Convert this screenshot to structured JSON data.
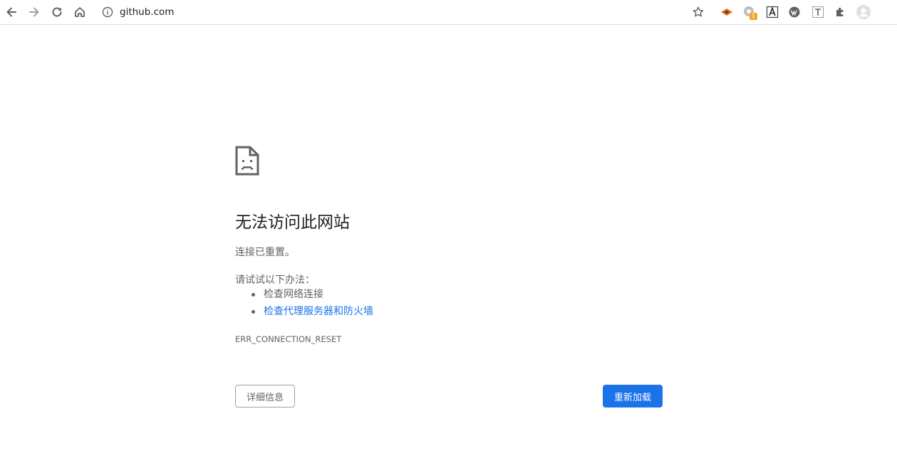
{
  "browser": {
    "url": "github.com",
    "icons": {
      "back": "arrow-left-icon",
      "forward": "arrow-right-icon",
      "reload": "reload-icon",
      "home": "home-icon",
      "site_info": "info-icon",
      "bookmark": "star-icon",
      "extensions": "puzzle-icon",
      "profile": "avatar-icon"
    },
    "extension_badge": "1"
  },
  "error_page": {
    "icon": "sad-document-icon",
    "title": "无法访问此网站",
    "message": "连接已重置。",
    "try_heading": "请试试以下办法：",
    "suggestions": [
      "检查网络连接",
      "检查代理服务器和防火墙"
    ],
    "error_code": "ERR_CONNECTION_RESET",
    "details_button": "详细信息",
    "reload_button": "重新加载"
  },
  "colors": {
    "accent": "#1a73e8",
    "text_primary": "#202124",
    "text_secondary": "#5f6368",
    "icon": "#5f6368"
  }
}
